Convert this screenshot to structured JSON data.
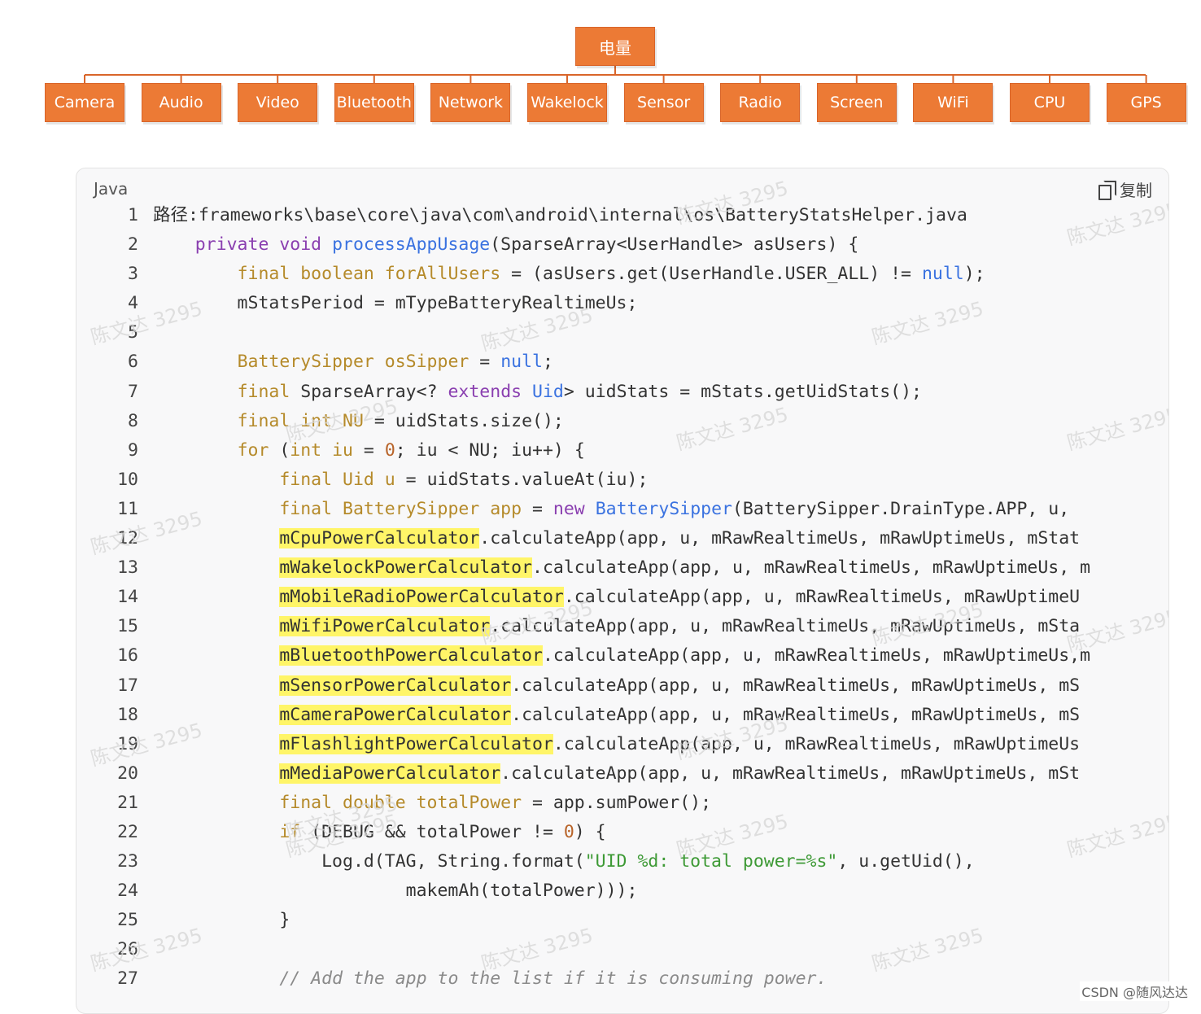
{
  "diagram": {
    "root": "电量",
    "children": [
      "Camera",
      "Audio",
      "Video",
      "Bluetooth",
      "Network",
      "Wakelock",
      "Sensor",
      "Radio",
      "Screen",
      "WiFi",
      "CPU",
      "GPS"
    ],
    "node_color": "#ec7a35",
    "line_color": "#d9652a"
  },
  "code_block": {
    "language": "Java",
    "copy_label": "复制",
    "lines": [
      {
        "n": "1",
        "segs": [
          {
            "t": "路径:frameworks\\base\\core\\java\\com\\android\\internal\\os\\BatteryStatsHelper.java"
          }
        ]
      },
      {
        "n": "2",
        "segs": [
          {
            "t": "    "
          },
          {
            "t": "private void ",
            "c": "kp"
          },
          {
            "t": "processAppUsage",
            "c": "fn"
          },
          {
            "t": "(SparseArray<UserHandle> asUsers) {"
          }
        ]
      },
      {
        "n": "3",
        "segs": [
          {
            "t": "        "
          },
          {
            "t": "final boolean forAllUsers",
            "c": "kw"
          },
          {
            "t": " = (asUsers.get(UserHandle.USER_ALL) != "
          },
          {
            "t": "null",
            "c": "fn"
          },
          {
            "t": ");"
          }
        ]
      },
      {
        "n": "4",
        "segs": [
          {
            "t": "        mStatsPeriod = mTypeBatteryRealtimeUs;"
          }
        ]
      },
      {
        "n": "5",
        "segs": [
          {
            "t": ""
          }
        ]
      },
      {
        "n": "6",
        "segs": [
          {
            "t": "        "
          },
          {
            "t": "BatterySipper osSipper",
            "c": "kw"
          },
          {
            "t": " = "
          },
          {
            "t": "null",
            "c": "fn"
          },
          {
            "t": ";"
          }
        ]
      },
      {
        "n": "7",
        "segs": [
          {
            "t": "        "
          },
          {
            "t": "final",
            "c": "kw"
          },
          {
            "t": " SparseArray<? "
          },
          {
            "t": "extends",
            "c": "kp"
          },
          {
            "t": " "
          },
          {
            "t": "Uid",
            "c": "fn"
          },
          {
            "t": "> uidStats = mStats.getUidStats();"
          }
        ]
      },
      {
        "n": "8",
        "segs": [
          {
            "t": "        "
          },
          {
            "t": "final int NU",
            "c": "kw"
          },
          {
            "t": " = uidStats.size();"
          }
        ]
      },
      {
        "n": "9",
        "segs": [
          {
            "t": "        "
          },
          {
            "t": "for",
            "c": "kw"
          },
          {
            "t": " ("
          },
          {
            "t": "int iu",
            "c": "kw"
          },
          {
            "t": " = "
          },
          {
            "t": "0",
            "c": "num"
          },
          {
            "t": "; iu < NU; iu++) {"
          }
        ]
      },
      {
        "n": "10",
        "segs": [
          {
            "t": "            "
          },
          {
            "t": "final Uid u",
            "c": "kw"
          },
          {
            "t": " = uidStats.valueAt(iu);"
          }
        ]
      },
      {
        "n": "11",
        "segs": [
          {
            "t": "            "
          },
          {
            "t": "final BatterySipper app",
            "c": "kw"
          },
          {
            "t": " = "
          },
          {
            "t": "new",
            "c": "kp"
          },
          {
            "t": " "
          },
          {
            "t": "BatterySipper",
            "c": "fn"
          },
          {
            "t": "(BatterySipper.DrainType.APP, u, "
          }
        ]
      },
      {
        "n": "12",
        "segs": [
          {
            "t": "            "
          },
          {
            "t": "mCpuPowerCalculator",
            "c": "hl"
          },
          {
            "t": ".calculateApp(app, u, mRawRealtimeUs, mRawUptimeUs, mStat"
          }
        ]
      },
      {
        "n": "13",
        "segs": [
          {
            "t": "            "
          },
          {
            "t": "mWakelockPowerCalculator",
            "c": "hl"
          },
          {
            "t": ".calculateApp(app, u, mRawRealtimeUs, mRawUptimeUs, m"
          }
        ]
      },
      {
        "n": "14",
        "segs": [
          {
            "t": "            "
          },
          {
            "t": "mMobileRadioPowerCalculator",
            "c": "hl"
          },
          {
            "t": ".calculateApp(app, u, mRawRealtimeUs, mRawUptimeU"
          }
        ]
      },
      {
        "n": "15",
        "segs": [
          {
            "t": "            "
          },
          {
            "t": "mWifiPowerCalculator",
            "c": "hl"
          },
          {
            "t": ".calculateApp(app, u, mRawRealtimeUs, mRawUptimeUs, mSta"
          }
        ]
      },
      {
        "n": "16",
        "segs": [
          {
            "t": "            "
          },
          {
            "t": "mBluetoothPowerCalculator",
            "c": "hl"
          },
          {
            "t": ".calculateApp(app, u, mRawRealtimeUs, mRawUptimeUs,m"
          }
        ]
      },
      {
        "n": "17",
        "segs": [
          {
            "t": "            "
          },
          {
            "t": "mSensorPowerCalculator",
            "c": "hl"
          },
          {
            "t": ".calculateApp(app, u, mRawRealtimeUs, mRawUptimeUs, mS"
          }
        ]
      },
      {
        "n": "18",
        "segs": [
          {
            "t": "            "
          },
          {
            "t": "mCameraPowerCalculator",
            "c": "hl"
          },
          {
            "t": ".calculateApp(app, u, mRawRealtimeUs, mRawUptimeUs, mS"
          }
        ]
      },
      {
        "n": "19",
        "segs": [
          {
            "t": "            "
          },
          {
            "t": "mFlashlightPowerCalculator",
            "c": "hl"
          },
          {
            "t": ".calculateApp(app, u, mRawRealtimeUs, mRawUptimeUs"
          }
        ]
      },
      {
        "n": "20",
        "segs": [
          {
            "t": "            "
          },
          {
            "t": "mMediaPowerCalculator",
            "c": "hl"
          },
          {
            "t": ".calculateApp(app, u, mRawRealtimeUs, mRawUptimeUs, mSt"
          }
        ]
      },
      {
        "n": "21",
        "segs": [
          {
            "t": "            "
          },
          {
            "t": "final double totalPower",
            "c": "kw"
          },
          {
            "t": " = app.sumPower();"
          }
        ]
      },
      {
        "n": "22",
        "segs": [
          {
            "t": "            "
          },
          {
            "t": "if",
            "c": "kw"
          },
          {
            "t": " (DEBUG && totalPower != "
          },
          {
            "t": "0",
            "c": "num"
          },
          {
            "t": ") {"
          }
        ]
      },
      {
        "n": "23",
        "segs": [
          {
            "t": "                Log.d(TAG, String.format("
          },
          {
            "t": "\"UID %d: total power=%s\"",
            "c": "str"
          },
          {
            "t": ", u.getUid(),"
          }
        ]
      },
      {
        "n": "24",
        "segs": [
          {
            "t": "                        makemAh(totalPower)));"
          }
        ]
      },
      {
        "n": "25",
        "segs": [
          {
            "t": "            }"
          }
        ]
      },
      {
        "n": "26",
        "segs": [
          {
            "t": ""
          }
        ]
      },
      {
        "n": "27",
        "segs": [
          {
            "t": "            "
          },
          {
            "t": "// Add the app to the list if it is consuming power.",
            "c": "cm"
          }
        ]
      }
    ]
  },
  "watermark": "陈文达 3295",
  "footer": "CSDN @随风达达"
}
